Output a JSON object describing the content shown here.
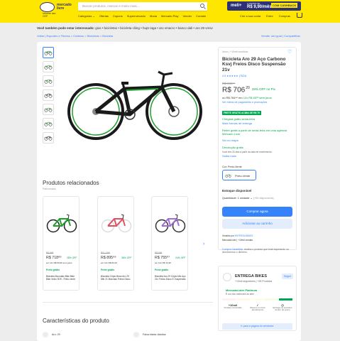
{
  "header": {
    "logo_text": "mercado livre",
    "search_placeholder": "Buscar produtos, marcas e muito mais…",
    "promo": {
      "brand": "meli+",
      "from": "A PARTIR DE",
      "price": "R$ 9,90/mês",
      "cashback": "COM CASHBACK"
    },
    "location": {
      "label": "Informe seu",
      "value": "CEP"
    },
    "nav": [
      "Categorias ⌄",
      "Ofertas",
      "Cupons",
      "Supermercado",
      "Moda",
      "Mercado Play",
      "Vender",
      "Contato"
    ],
    "user": [
      "Crie a sua conta",
      "Entre",
      "Compras"
    ]
  },
  "also_searched": {
    "prefix": "Você também pode estar interessado:",
    "items": "gios • bicicletas • bicicleta cliing • hupt raga • aro vmacro • banco dali • aro 29 vmsv"
  },
  "breadcrumb": "Voltar  |  Esportes e Fitness > Ciclismo > Bicicletas > Bicicleta",
  "crumb_actions": "Vender um igual  |  Compartilhar",
  "product": {
    "condition": "Novo  |  +10mil vendidos",
    "title": "Bicicleta Aro 29 Aço Carbono Ksvj Freios Disco Suspensão 21v",
    "rating": "4.5 ★★★★★ (7624)",
    "old_price": "R$ 999⁹⁹",
    "price": "R$ 706",
    "price_cents": "20",
    "discount": "29% OFF no Pix",
    "installments_prefix": "ou R$ 784⁴⁴ em",
    "installments_value": "12x R$ 65⁶⁵ sem juros",
    "payment_link": "Ver meios de pagamento e promoções",
    "promo_tag": "FRETE GRÁTIS ACIMA DE R$ 79",
    "shipping": {
      "arrives": "Chegará grátis sexta-feira",
      "more_forms": "Mais formas de entrega",
      "pickup": "Retire grátis a partir de sexta-feira em uma agência Mercado Livre",
      "map": "Ver no mapa",
      "returns": "Devolução grátis",
      "returns_sub": "Você tem 30 dias a partir da data de recebimento.",
      "returns_link": "Saiba mais"
    },
    "variant_label": "Cor: Preto-Verde",
    "variant_value": "Preto-Verde",
    "stock": "Estoque disponível",
    "qty_label": "Quantidade: 1 unidade ⌄",
    "qty_note": "(+50 disponíveis)",
    "buy": "Comprar agora",
    "add_cart": "Adicionar ao carrinho",
    "sold_by_prefix": "Vendido por",
    "sold_by": "ENTREGA BIKES",
    "sold_by_sub": "MercadoLíder | +10mil vendas",
    "guarantee_prefix": "Compra Garantida,",
    "guarantee": "receba o produto que está esperando ou devolvemos o dinheiro."
  },
  "related": {
    "title": "Produtos relacionados",
    "sub": "Patrocinado",
    "cards": [
      {
        "old": "R$ 999",
        "price": "R$ 718⁸⁹",
        "off": "28% OFF",
        "inst": "em 12x R$ 59,90 sem juros",
        "ship": "Frete grátis",
        "name": "Bicicleta Mountain Bike Bike Bike Velox R29 - Preto-verde",
        "frame": "#222",
        "accent": "#1ea02e"
      },
      {
        "old": "R$ 1.399",
        "price": "R$ 895⁹⁹",
        "off": "36% OFF",
        "inst": "em 12x R$ 84,43",
        "ship": "Frete grátis",
        "name": "Bicicleta Cripto Bean Aro 29 Mtb 21 Marchas Freios Disco",
        "frame": "#ddd",
        "accent": "#e05060"
      },
      {
        "old": "R$ 999",
        "price": "R$ 755⁰⁷",
        "off": "24% OFF",
        "inst": "em 12x R$ 72,99",
        "ship": "Frete grátis",
        "name": "Bicicleta Aro 29 Cripto Mtc Aço 21v Freios Disco E Suspensão",
        "frame": "#333",
        "accent": "#a070d0"
      }
    ]
  },
  "specs": {
    "title": "Características do produto",
    "items": [
      {
        "text": "Aro: 29"
      },
      {
        "text": "Faixa etária: Adultos"
      }
    ]
  },
  "seller": {
    "name": "ENTREGA BIKES",
    "sales": "+10mil seguidores  |  +28 Produtos",
    "follow": "Seguir",
    "platinum": "MercadoLíder Platinum",
    "platinum_sub": "É um dos melhores do site!",
    "metrics": [
      {
        "value": "+10mil",
        "label": "Vendas concluídas"
      },
      {
        "value": "",
        "label": "Oferece um bom atendimento"
      },
      {
        "value": "",
        "label": "Entrega os produtos dentro do prazo"
      }
    ],
    "link": "Ir para a página do vendedor"
  },
  "colors": {
    "accent": "#3483fa",
    "brand": "#ffe600",
    "success": "#00a650",
    "bike_accent": "#1ea02e"
  }
}
